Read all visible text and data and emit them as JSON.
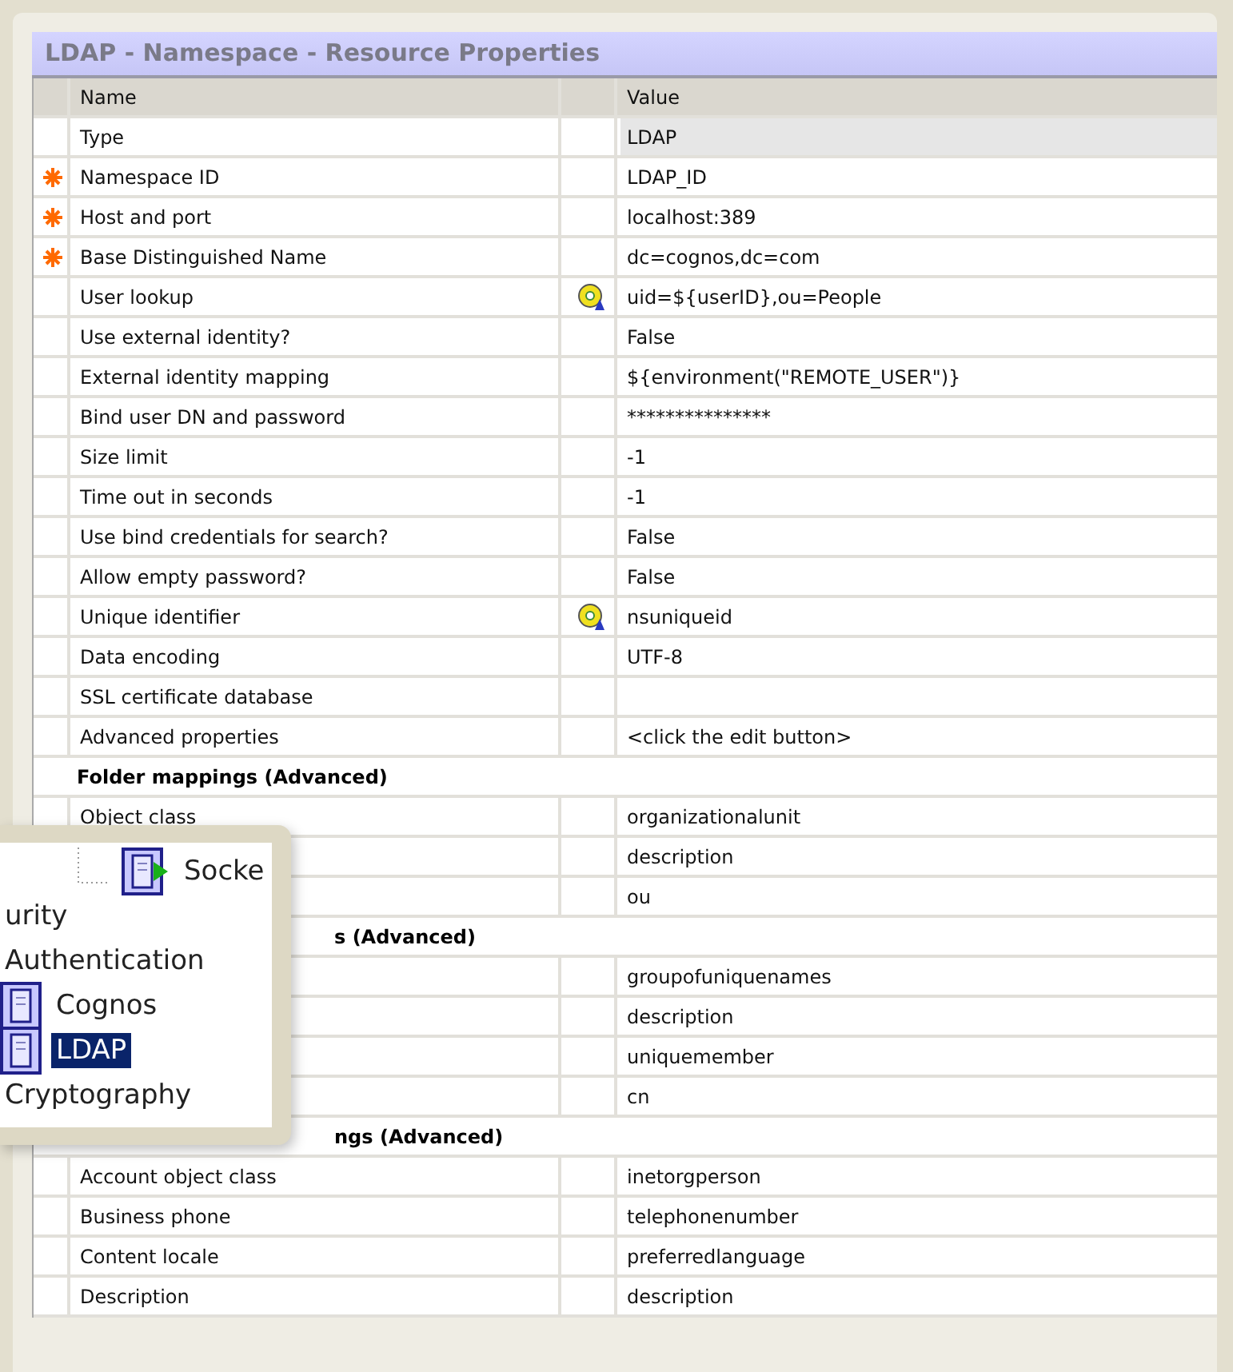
{
  "panel": {
    "title": "LDAP - Namespace - Resource Properties"
  },
  "table": {
    "columns": [
      "Name",
      "Value"
    ],
    "rows": [
      {
        "kind": "property",
        "name": "Type",
        "value": "LDAP",
        "required": false,
        "lookup": false,
        "readonly": true
      },
      {
        "kind": "property",
        "name": "Namespace ID",
        "value": "LDAP_ID",
        "required": true,
        "lookup": false,
        "readonly": false
      },
      {
        "kind": "property",
        "name": "Host and port",
        "value": "localhost:389",
        "required": true,
        "lookup": false,
        "readonly": false
      },
      {
        "kind": "property",
        "name": "Base Distinguished Name",
        "value": "dc=cognos,dc=com",
        "required": true,
        "lookup": false,
        "readonly": false
      },
      {
        "kind": "property",
        "name": "User lookup",
        "value": "uid=${userID},ou=People",
        "required": false,
        "lookup": true,
        "readonly": false
      },
      {
        "kind": "property",
        "name": "Use external identity?",
        "value": "False",
        "required": false,
        "lookup": false,
        "readonly": false
      },
      {
        "kind": "property",
        "name": "External identity mapping",
        "value": "${environment(\"REMOTE_USER\")}",
        "required": false,
        "lookup": false,
        "readonly": false
      },
      {
        "kind": "property",
        "name": "Bind user DN and password",
        "value": "***************",
        "required": false,
        "lookup": false,
        "readonly": false
      },
      {
        "kind": "property",
        "name": "Size limit",
        "value": "-1",
        "required": false,
        "lookup": false,
        "readonly": false
      },
      {
        "kind": "property",
        "name": "Time out in seconds",
        "value": "-1",
        "required": false,
        "lookup": false,
        "readonly": false
      },
      {
        "kind": "property",
        "name": "Use bind credentials for search?",
        "value": "False",
        "required": false,
        "lookup": false,
        "readonly": false
      },
      {
        "kind": "property",
        "name": "Allow empty password?",
        "value": "False",
        "required": false,
        "lookup": false,
        "readonly": false
      },
      {
        "kind": "property",
        "name": "Unique identifier",
        "value": "nsuniqueid",
        "required": false,
        "lookup": true,
        "readonly": false
      },
      {
        "kind": "property",
        "name": "Data encoding",
        "value": "UTF-8",
        "required": false,
        "lookup": false,
        "readonly": false
      },
      {
        "kind": "property",
        "name": "SSL certificate database",
        "required": false,
        "lookup": false,
        "readonly": false
      },
      {
        "kind": "property",
        "name": "Advanced properties",
        "value": "<click the edit button>",
        "required": false,
        "lookup": false,
        "readonly": false
      },
      {
        "kind": "section",
        "title": "Folder mappings (Advanced)",
        "covered": false
      },
      {
        "kind": "property",
        "name": "Object class",
        "value": "organizationalunit",
        "required": false,
        "lookup": false,
        "readonly": false
      },
      {
        "kind": "property",
        "value": "description",
        "lookup": false,
        "readonly": false
      },
      {
        "kind": "property",
        "value": "ou",
        "lookup": false,
        "readonly": false
      },
      {
        "kind": "section",
        "title": "s (Advanced)",
        "covered": true
      },
      {
        "kind": "property",
        "value": "groupofuniquenames",
        "lookup": false,
        "readonly": false
      },
      {
        "kind": "property",
        "value": "description",
        "lookup": false,
        "readonly": false
      },
      {
        "kind": "property",
        "value": "uniquemember",
        "lookup": false,
        "readonly": false
      },
      {
        "kind": "property",
        "value": "cn",
        "lookup": false,
        "readonly": false
      },
      {
        "kind": "section",
        "title": "ngs (Advanced)",
        "covered": true
      },
      {
        "kind": "property",
        "name": "Account object class",
        "value": "inetorgperson",
        "required": false,
        "lookup": false,
        "readonly": false
      },
      {
        "kind": "property",
        "name": "Business phone",
        "value": "telephonenumber",
        "required": false,
        "lookup": false,
        "readonly": false
      },
      {
        "kind": "property",
        "name": "Content locale",
        "value": "preferredlanguage",
        "required": false,
        "lookup": false,
        "readonly": false
      },
      {
        "kind": "property",
        "name": "Description",
        "value": "description",
        "required": false,
        "lookup": false,
        "readonly": false
      }
    ]
  },
  "inset_tree": {
    "items": [
      {
        "label": "Socke",
        "kind": "socket",
        "selected": false
      },
      {
        "label": "urity",
        "kind": "text",
        "selected": false,
        "children": [
          {
            "label": "Authentication",
            "kind": "text",
            "selected": false,
            "children": [
              {
                "label": "Cognos",
                "kind": "namespace",
                "selected": false
              },
              {
                "label": "LDAP",
                "kind": "namespace",
                "selected": true
              }
            ]
          },
          {
            "label": "Cryptography",
            "kind": "text",
            "selected": false
          }
        ]
      }
    ]
  }
}
